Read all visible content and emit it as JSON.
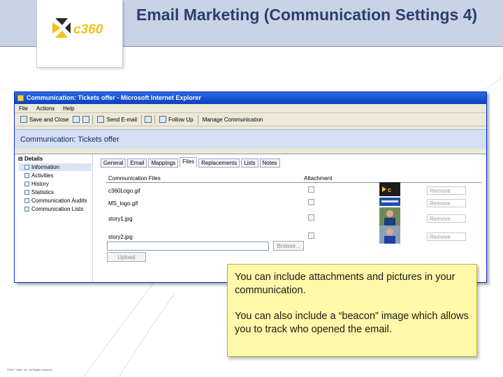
{
  "slide": {
    "title": "Email Marketing (Communication Settings 4)",
    "logo_text": "c360",
    "copyright": "©2007 c360, Inc. All Rights reserved."
  },
  "window": {
    "title": "Communication: Tickets offer - Microsoft Internet Explorer",
    "menu": [
      "File",
      "Actions",
      "Help"
    ],
    "toolbar": {
      "save_close": "Save and Close",
      "send_email": "Send E-mail",
      "follow_up": "Follow Up",
      "manage": "Manage Communication"
    },
    "form_title": "Communication: Tickets offer"
  },
  "nav": {
    "header": "Details",
    "items": [
      {
        "label": "Information",
        "selected": true
      },
      {
        "label": "Activities",
        "selected": false
      },
      {
        "label": "History",
        "selected": false
      },
      {
        "label": "Statistics",
        "selected": false
      },
      {
        "label": "Communication Audits",
        "selected": false
      },
      {
        "label": "Communication Lists",
        "selected": false
      }
    ]
  },
  "tabs": [
    "General",
    "Email",
    "Mappings",
    "Files",
    "Replacements",
    "Lists",
    "Notes"
  ],
  "active_tab": "Files",
  "files": {
    "col_files": "Communication Files",
    "col_attachment": "Attachment",
    "rows": [
      {
        "name": "c360Logo.gif",
        "attachment": false,
        "remove": "Remove",
        "thumb": "c360-logo"
      },
      {
        "name": "MS_logo.gif",
        "attachment": false,
        "remove": "Remove",
        "thumb": "microsoft-logo"
      },
      {
        "name": "story1.jpg",
        "attachment": false,
        "remove": "Remove",
        "thumb": "person-photo"
      },
      {
        "name": "story2.jpg",
        "attachment": false,
        "remove": "Remove",
        "thumb": "person-photo"
      }
    ],
    "browse_label": "Browse...",
    "upload_label": "Upload"
  },
  "callout": {
    "para1": "You can include attachments and pictures in your communication.",
    "para2": "You can also include a “beacon” image which allows you to track who opened the email."
  },
  "colors": {
    "header_band": "#c9d3e6",
    "title": "#2b3e6e",
    "callout_bg": "#fff8a8",
    "ie_titlebar": "#0a3fc0"
  }
}
